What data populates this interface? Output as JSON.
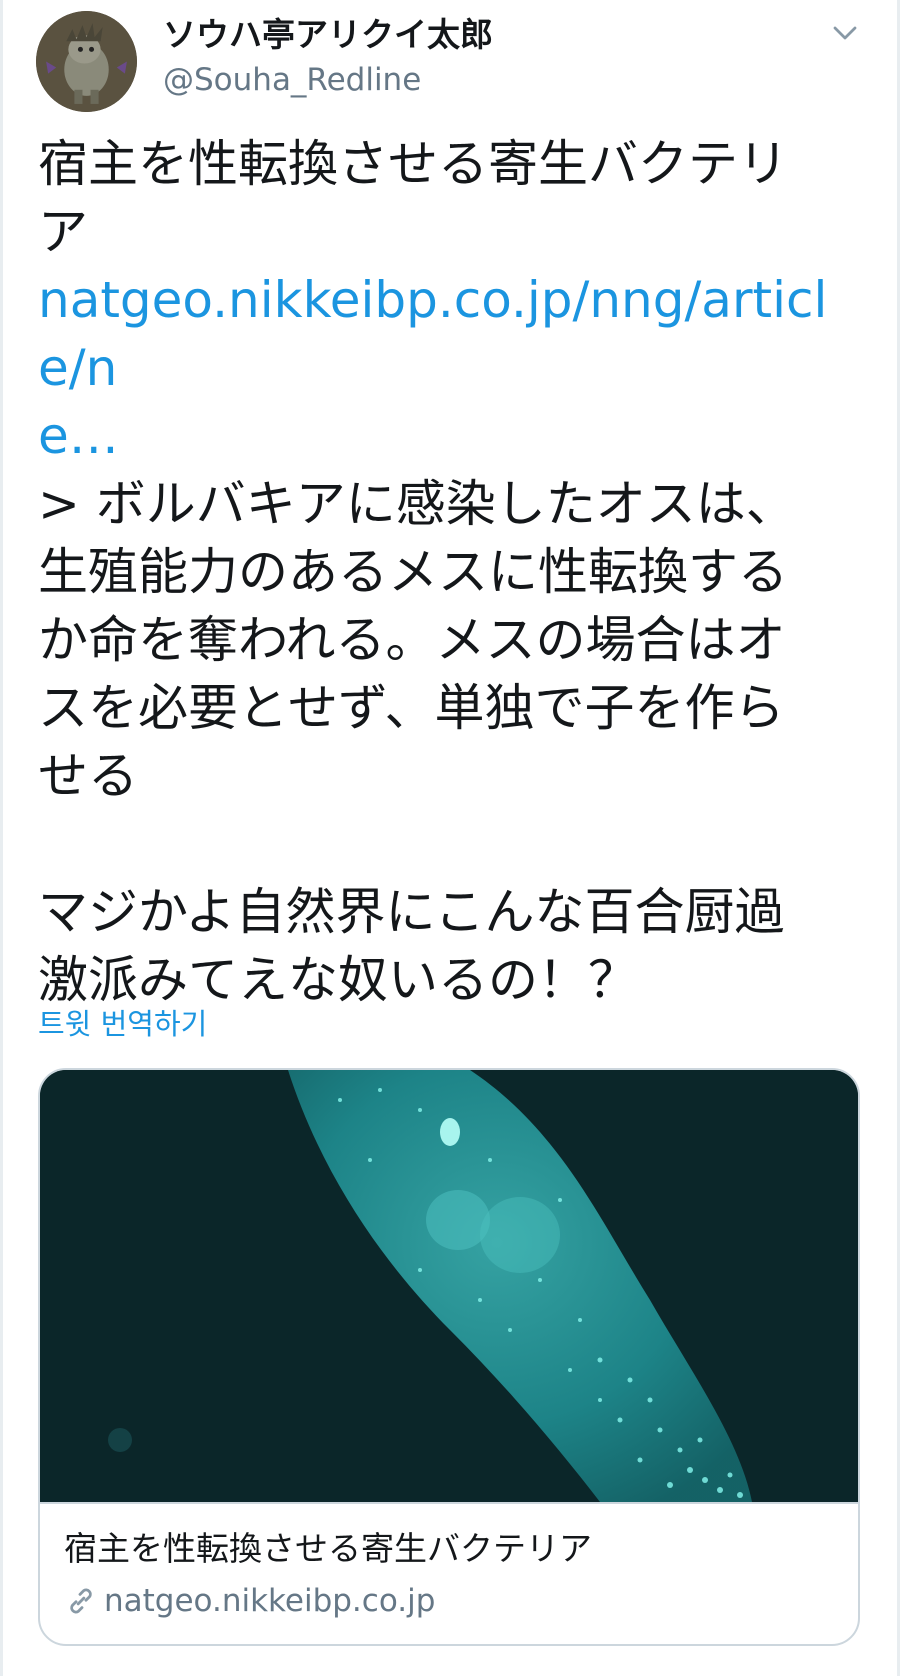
{
  "user": {
    "display_name": "ソウハ亭アリクイ太郎",
    "handle": "@Souha_Redline"
  },
  "tweet": {
    "lines": [
      "宿主を性転換させる寄生バクテリ",
      "ア",
      "natgeo.nikkeibp.co.jp/nng/article/n",
      "e…",
      "> ボルバキアに感染したオスは、",
      "生殖能力のあるメスに性転換する",
      "か命を奪われる。メスの場合はオ",
      "スを必要とせず、単独で子を作ら",
      "せる",
      "マジかよ自然界にこんな百合厨過",
      "激派みてえな奴いるの！？"
    ],
    "translate_label": "트윗 번역하기"
  },
  "card": {
    "title": "宿主を性転換させる寄生バクテリア",
    "domain": "natgeo.nikkeibp.co.jp"
  },
  "icons": {
    "menu": "chevron-down-icon",
    "link": "link-icon"
  },
  "colors": {
    "link": "#1b95e0",
    "secondary": "#657786",
    "text": "#14171a",
    "card_border": "#ccd6dd",
    "image_bg": "#0c2a2c",
    "image_glow": "#2ec9c4"
  }
}
